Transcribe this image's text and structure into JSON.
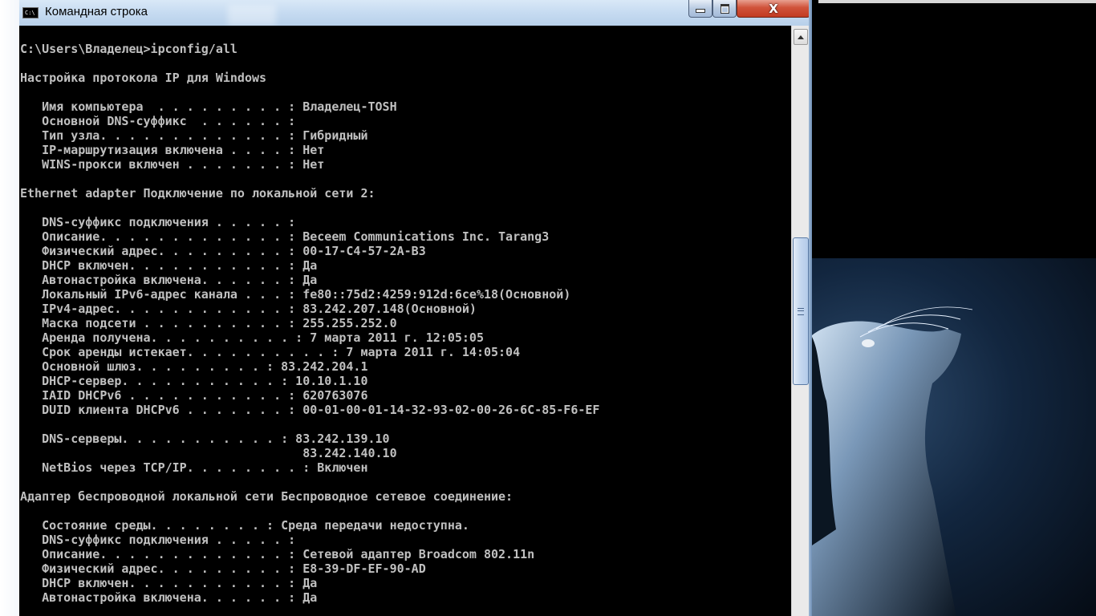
{
  "window": {
    "title": "Командная строка",
    "icon": "cmd-icon",
    "controls": {
      "minimize": "minimize-icon",
      "maximize": "restore-icon",
      "close": "close-icon"
    },
    "close_glyph": "X"
  },
  "colors": {
    "console_bg": "#000000",
    "console_text": "#c0c0c0",
    "title_bar": "#c6dbf1",
    "close_button": "#c23b22"
  },
  "console": {
    "lines": [
      "C:\\Users\\Владелец>ipconfig/all",
      "",
      "Настройка протокола IP для Windows",
      "",
      "   Имя компьютера  . . . . . . . . . : Владелец-TOSH",
      "   Основной DNS-суффикс  . . . . . . :",
      "   Тип узла. . . . . . . . . . . . . : Гибридный",
      "   IP-маршрутизация включена . . . . : Нет",
      "   WINS-прокси включен . . . . . . . : Нет",
      "",
      "Ethernet adapter Подключение по локальной сети 2:",
      "",
      "   DNS-суффикс подключения . . . . . :",
      "   Описание. . . . . . . . . . . . . : Beceem Communications Inc. Tarang3",
      "   Физический адрес. . . . . . . . . : 00-17-C4-57-2A-B3",
      "   DHCP включен. . . . . . . . . . . : Да",
      "   Автонастройка включена. . . . . . : Да",
      "   Локальный IPv6-адрес канала . . . : fe80::75d2:4259:912d:6ce%18(Основной)",
      "   IPv4-адрес. . . . . . . . . . . . : 83.242.207.148(Основной)",
      "   Маска подсети . . . . . . . . . . : 255.255.252.0",
      "   Аренда получена. . . . . . . . . . : 7 марта 2011 г. 12:05:05",
      "   Срок аренды истекает. . . . . . . . . . : 7 марта 2011 г. 14:05:04",
      "   Основной шлюз. . . . . . . . . : 83.242.204.1",
      "   DHCP-сервер. . . . . . . . . . . : 10.10.1.10",
      "   IAID DHCPv6 . . . . . . . . . . . : 620763076",
      "   DUID клиента DHCPv6 . . . . . . . : 00-01-00-01-14-32-93-02-00-26-6C-85-F6-EF",
      "",
      "   DNS-серверы. . . . . . . . . . . : 83.242.139.10",
      "                                       83.242.140.10",
      "   NetBios через TCP/IP. . . . . . . . : Включен",
      "",
      "Адаптер беспроводной локальной сети Беспроводное сетевое соединение:",
      "",
      "   Состояние среды. . . . . . . . : Среда передачи недоступна.",
      "   DNS-суффикс подключения . . . . . :",
      "   Описание. . . . . . . . . . . . . : Сетевой адаптер Broadcom 802.11n",
      "   Физический адрес. . . . . . . . . : E8-39-DF-EF-90-AD",
      "   DHCP включен. . . . . . . . . . . : Да",
      "   Автонастройка включена. . . . . . : Да"
    ]
  },
  "scrollbar": {
    "up_icon": "arrow-up-icon",
    "thumb_icon": "grip-icon",
    "position_fraction": 0.45
  },
  "desktop": {
    "wallpaper": "cat-silhouette-wallpaper"
  }
}
